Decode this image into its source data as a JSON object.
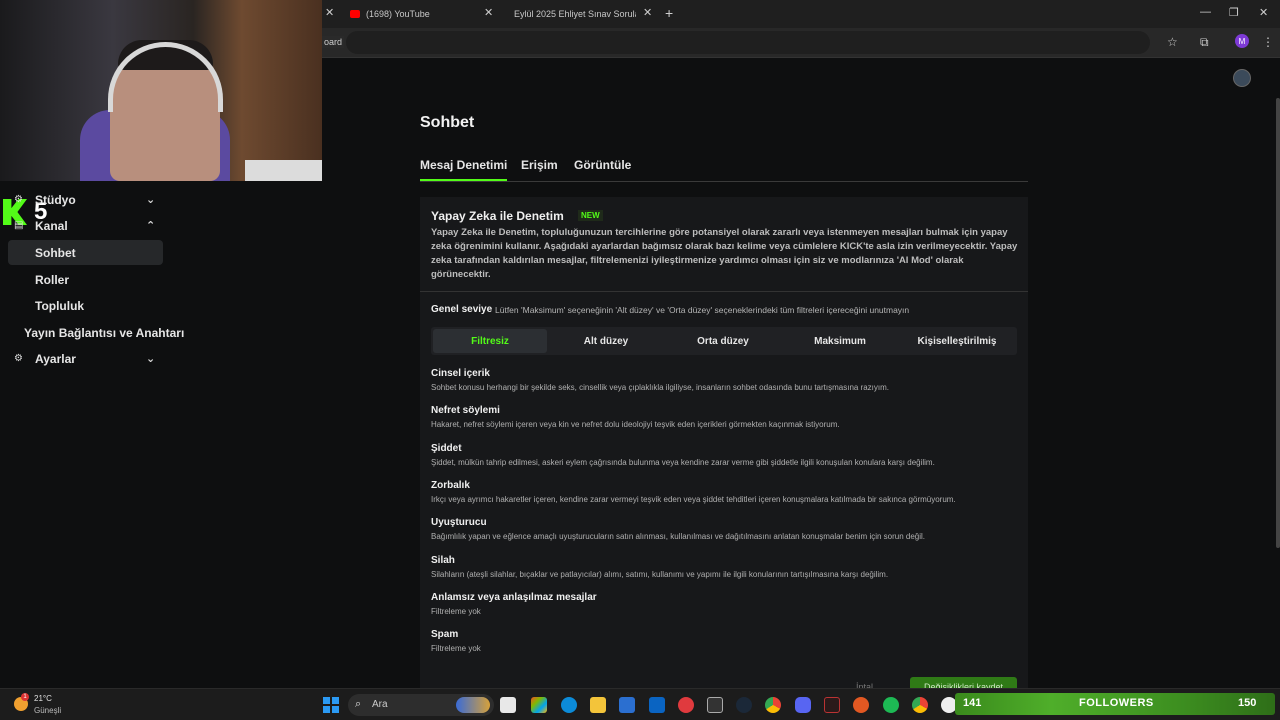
{
  "browser": {
    "tabs": [
      {
        "label": "(1698) YouTube"
      },
      {
        "label": "Eylül 2025 Ehliyet Sınav Soruları"
      }
    ],
    "new_tab_symbol": "+",
    "close_symbol": "✕",
    "board_fragment": "oard",
    "profile_initial": "M",
    "window_controls": [
      "—",
      "❐",
      "✕"
    ]
  },
  "sidebar": {
    "overlay_number": "5",
    "items": [
      {
        "label": "Stüdyo",
        "icon": "gear-icon",
        "chevron": "⌄"
      },
      {
        "label": "Kanal",
        "icon": "channel-icon",
        "chevron": "⌃"
      },
      {
        "label": "Sohbet"
      },
      {
        "label": "Roller"
      },
      {
        "label": "Topluluk"
      },
      {
        "label": "Yayın Bağlantısı ve Anahtarı"
      },
      {
        "label": "Ayarlar",
        "icon": "gear-icon",
        "chevron": "⌄"
      }
    ]
  },
  "main": {
    "title": "Sohbet",
    "tabs": [
      {
        "label": "Mesaj Denetimi",
        "active": true
      },
      {
        "label": "Erişim"
      },
      {
        "label": "Görüntüle"
      }
    ],
    "ai": {
      "title": "Yapay Zeka ile Denetim",
      "badge": "NEW",
      "description": "Yapay Zeka ile Denetim, topluluğunuzun tercihlerine göre potansiyel olarak zararlı veya istenmeyen mesajları bulmak için yapay zeka öğrenimini kullanır. Aşağıdaki ayarlardan bağımsız olarak bazı kelime veya cümlelere KICK'te asla izin verilmeyecektir. Yapay zeka tarafından kaldırılan mesajlar, filtrelemenizi iyileştirmenize yardımcı olması için siz ve modlarınıza 'AI Mod' olarak görünecektir."
    },
    "general_level": {
      "label": "Genel seviye",
      "note": "Lütfen 'Maksimum' seçeneğinin 'Alt düzey' ve 'Orta düzey' seçeneklerindeki tüm filtreleri içereceğini unutmayın",
      "options": [
        "Filtresiz",
        "Alt düzey",
        "Orta düzey",
        "Maksimum",
        "Kişiselleştirilmiş"
      ],
      "selected": "Filtresiz"
    },
    "categories": [
      {
        "title": "Cinsel içerik",
        "desc": "Sohbet konusu herhangi bir şekilde seks, cinsellik veya çıplaklıkla ilgiliyse, insanların sohbet odasında bunu tartışmasına razıyım."
      },
      {
        "title": "Nefret söylemi",
        "desc": "Hakaret, nefret söylemi içeren veya kin ve nefret dolu ideolojiyi teşvik eden içerikleri görmekten kaçınmak istiyorum."
      },
      {
        "title": "Şiddet",
        "desc": "Şiddet, mülkün tahrip edilmesi, askeri eylem çağrısında bulunma veya kendine zarar verme gibi şiddetle ilgili konuşulan konulara karşı değilim."
      },
      {
        "title": "Zorbalık",
        "desc": "Irkçı veya ayrımcı hakaretler içeren, kendine zarar vermeyi teşvik eden veya şiddet tehditleri içeren konuşmalara katılmada bir sakınca görmüyorum."
      },
      {
        "title": "Uyuşturucu",
        "desc": "Bağımlılık yapan ve eğlence amaçlı uyuşturucuların satın alınması, kullanılması ve dağıtılmasını anlatan konuşmalar benim için sorun değil."
      },
      {
        "title": "Silah",
        "desc": "Silahların (ateşli silahlar, bıçaklar ve patlayıcılar) alımı, satımı, kullanımı ve yapımı ile ilgili konularının tartışılmasına karşı değilim."
      },
      {
        "title": "Anlamsız veya anlaşılmaz mesajlar",
        "desc": "Filtreleme yok"
      },
      {
        "title": "Spam",
        "desc": "Filtreleme yok"
      }
    ],
    "cancel_label": "İptal Et",
    "save_label": "Değişiklikleri kaydet"
  },
  "taskbar": {
    "weather_temp": "21°C",
    "weather_cond": "Güneşli",
    "weather_badge": "1",
    "search_label": "Ara"
  },
  "followers": {
    "label": "FOLLOWERS",
    "current": "141",
    "goal": "150"
  },
  "colors": {
    "accent": "#53fc18",
    "background": "#0e0f10",
    "panel": "#17181a"
  }
}
